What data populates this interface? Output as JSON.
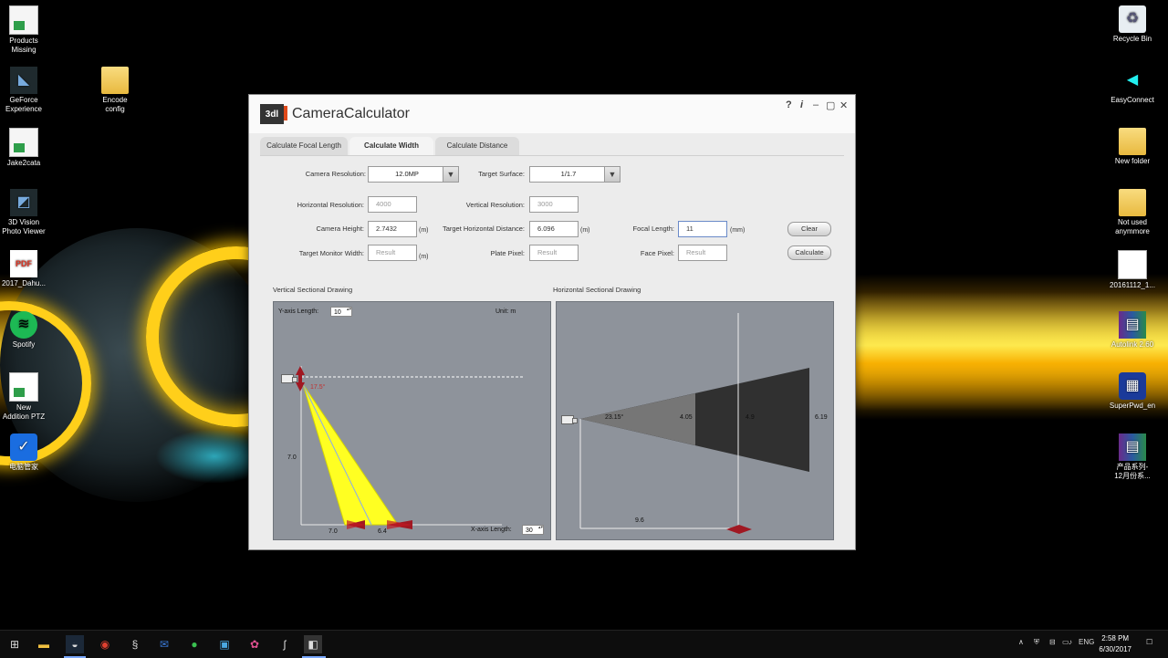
{
  "desktop": {
    "icons_left": [
      {
        "label": "Products\nMissing",
        "icon": "excel-file-icon"
      },
      {
        "label": "GeForce\nExperience",
        "icon": "geforce-icon"
      },
      {
        "label": "Jake2cata",
        "icon": "excel-file-icon"
      },
      {
        "label": "3D Vision\nPhoto Viewer",
        "icon": "3d-vision-icon"
      },
      {
        "label": "2017_Dahu...",
        "icon": "pdf-icon"
      },
      {
        "label": "Spotify",
        "icon": "spotify-icon"
      },
      {
        "label": "New\nAddition PTZ",
        "icon": "document-icon"
      },
      {
        "label": "电脑管家",
        "icon": "shield-app-icon"
      }
    ],
    "icon_encode": {
      "label": "Encode\nconfig",
      "icon": "folder-icon"
    },
    "icons_right": [
      {
        "label": "Recycle Bin",
        "icon": "recycle-bin-icon"
      },
      {
        "label": "EasyConnect",
        "icon": "easyconnect-icon"
      },
      {
        "label": "New folder",
        "icon": "folder-icon"
      },
      {
        "label": "Not used\nanymmore",
        "icon": "folder-icon"
      },
      {
        "label": "20161112_1...",
        "icon": "blank-file-icon"
      },
      {
        "label": "Autolink 2.60",
        "icon": "winrar-icon"
      },
      {
        "label": "SuperPwd_en",
        "icon": "superpwd-icon"
      },
      {
        "label": "产品系列-\n12月份系...",
        "icon": "winrar-icon"
      }
    ]
  },
  "app": {
    "title": "CameraCalculator",
    "logo_text": "3dl",
    "window_controls": {
      "help": "?",
      "info": "i",
      "minimize": "–",
      "maximize": "▢",
      "close": "✕"
    },
    "tabs": [
      {
        "label": "Calculate Focal Length",
        "active": false
      },
      {
        "label": "Calculate Width",
        "active": true
      },
      {
        "label": "Calculate Distance",
        "active": false
      }
    ],
    "form": {
      "camera_resolution_label": "Camera Resolution:",
      "camera_resolution_value": "12.0MP",
      "target_surface_label": "Target Surface:",
      "target_surface_value": "1/1.7",
      "horizontal_resolution_label": "Horizontal Resolution:",
      "horizontal_resolution_value": "4000",
      "vertical_resolution_label": "Vertical Resolution:",
      "vertical_resolution_value": "3000",
      "camera_height_label": "Camera Height:",
      "camera_height_value": "2.7432",
      "camera_height_unit": "(m)",
      "target_horizontal_distance_label": "Target Horizontal Distance:",
      "target_horizontal_distance_value": "6.096",
      "target_horizontal_distance_unit": "(m)",
      "focal_length_label": "Focal Length:",
      "focal_length_value": "11",
      "focal_length_unit": "(mm)",
      "target_monitor_width_label": "Target Monitor Width:",
      "target_monitor_width_placeholder": "Result",
      "target_monitor_width_unit": "(m)",
      "plate_pixel_label": "Plate Pixel:",
      "plate_pixel_placeholder": "Result",
      "face_pixel_label": "Face Pixel:",
      "face_pixel_placeholder": "Result",
      "clear_button": "Clear",
      "calculate_button": "Calculate"
    },
    "vertical_drawing": {
      "title": "Vertical Sectional Drawing",
      "y_axis_length_label": "Y-axis Length:",
      "y_axis_length_value": "10",
      "unit_label": "Unit: m",
      "angle_label": "17.5°",
      "y_value_label": "7.0",
      "x_near_label": "7.0",
      "x_far_label": "6.4",
      "x_axis_length_label": "X-axis Length:",
      "x_axis_length_value": "30"
    },
    "horizontal_drawing": {
      "title": "Horizontal Sectional Drawing",
      "angle_label": "23.15°",
      "width_near_label": "4.05",
      "width_mid_label": "4.9",
      "width_far_label": "6.19",
      "distance_label": "9.6"
    }
  },
  "taskbar": {
    "time": "2:58 PM",
    "date": "6/30/2017",
    "language": "ENG",
    "tray_icons": [
      "chevron-up-icon",
      "defender-icon",
      "network-icon",
      "display-icon",
      "volume-icon"
    ],
    "apps": [
      "windows-start-icon",
      "file-explorer-icon",
      "steam-icon",
      "chrome-icon",
      "app-s-icon",
      "outlook-icon",
      "wechat-icon",
      "remote-icon",
      "pinwheel-icon",
      "settings-s-icon",
      "camera-calculator-icon"
    ]
  }
}
